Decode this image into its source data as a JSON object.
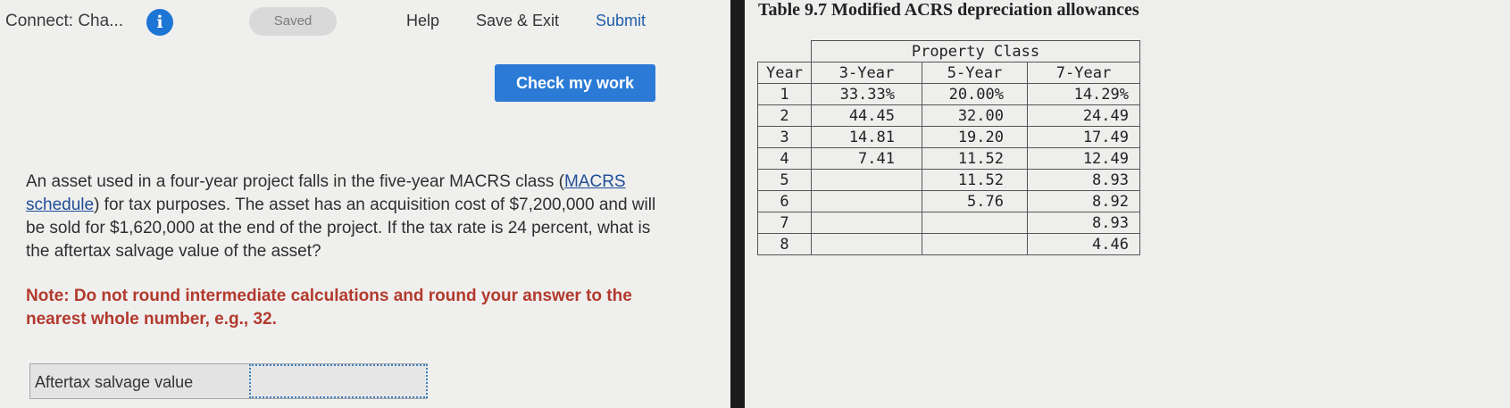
{
  "header": {
    "title": "Connect: Cha...",
    "saved_label": "Saved",
    "help_label": "Help",
    "save_exit_label": "Save & Exit",
    "submit_label": "Submit"
  },
  "check_button_label": "Check my work",
  "question": {
    "text_before_link": "An asset used in a four-year project falls in the five-year MACRS class (",
    "link_text": "MACRS schedule",
    "text_after_link": ") for tax purposes. The asset has an acquisition cost of $7,200,000 and will be sold for $1,620,000 at the end of the project. If the tax rate is 24 percent, what is the aftertax salvage value of the asset?",
    "note": "Note: Do not round intermediate calculations and round your answer to the nearest whole number, e.g., 32."
  },
  "answer": {
    "label": "Aftertax salvage value",
    "value": ""
  },
  "table": {
    "title": "Table 9.7 Modified ACRS depreciation allowances",
    "group_header": "Property Class",
    "year_header": "Year",
    "columns": [
      "3-Year",
      "5-Year",
      "7-Year"
    ],
    "rows": [
      {
        "year": "1",
        "y3": "33.33%",
        "y5": "20.00%",
        "y7": "14.29%"
      },
      {
        "year": "2",
        "y3": "44.45",
        "y5": "32.00",
        "y7": "24.49"
      },
      {
        "year": "3",
        "y3": "14.81",
        "y5": "19.20",
        "y7": "17.49"
      },
      {
        "year": "4",
        "y3": "7.41",
        "y5": "11.52",
        "y7": "12.49"
      },
      {
        "year": "5",
        "y3": "",
        "y5": "11.52",
        "y7": "8.93"
      },
      {
        "year": "6",
        "y3": "",
        "y5": "5.76",
        "y7": "8.92"
      },
      {
        "year": "7",
        "y3": "",
        "y5": "",
        "y7": "8.93"
      },
      {
        "year": "8",
        "y3": "",
        "y5": "",
        "y7": "4.46"
      }
    ]
  },
  "colors": {
    "accent": "#2a7ad6",
    "note": "#b33a2e",
    "link": "#1f4e96"
  }
}
